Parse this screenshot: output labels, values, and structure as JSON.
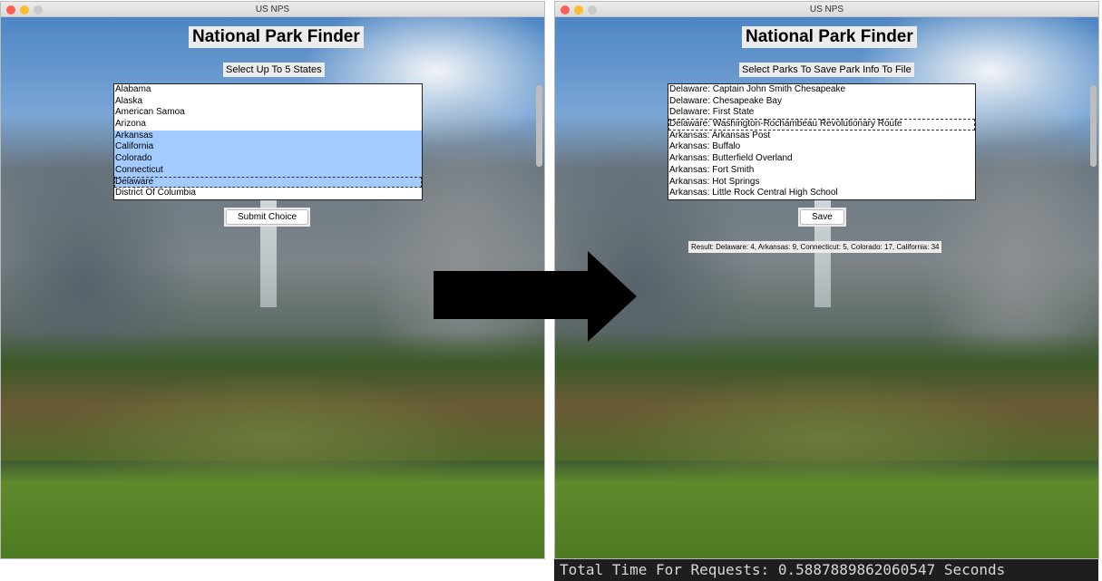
{
  "colors": {
    "selection": "#a4cbff",
    "close": "#fc5f57",
    "minimize": "#fdbc2e",
    "zoom": "#c9c9c9"
  },
  "window1": {
    "title": "US NPS",
    "heading": "National Park Finder",
    "prompt": "Select Up To 5 States",
    "states": [
      {
        "label": "Alabama",
        "selected": false
      },
      {
        "label": "Alaska",
        "selected": false
      },
      {
        "label": "American Samoa",
        "selected": false
      },
      {
        "label": "Arizona",
        "selected": false
      },
      {
        "label": "Arkansas",
        "selected": true
      },
      {
        "label": "California",
        "selected": true
      },
      {
        "label": "Colorado",
        "selected": true
      },
      {
        "label": "Connecticut",
        "selected": true
      },
      {
        "label": "Delaware",
        "selected": true,
        "focused": true
      },
      {
        "label": "District Of Columbia",
        "selected": false
      }
    ],
    "submit_label": "Submit Choice"
  },
  "arrow_icon": "right-arrow-icon",
  "window2": {
    "title": "US NPS",
    "heading": "National Park Finder",
    "prompt": "Select Parks To Save Park Info To File",
    "parks": [
      {
        "label": "Delaware: Captain John Smith Chesapeake"
      },
      {
        "label": "Delaware: Chesapeake Bay"
      },
      {
        "label": "Delaware: First State"
      },
      {
        "label": "Delaware: Washington-Rochambeau Revolutionary Route",
        "focused": true
      },
      {
        "label": "Arkansas: Arkansas Post"
      },
      {
        "label": "Arkansas: Buffalo"
      },
      {
        "label": "Arkansas: Butterfield Overland"
      },
      {
        "label": "Arkansas: Fort Smith"
      },
      {
        "label": "Arkansas: Hot Springs"
      },
      {
        "label": "Arkansas: Little Rock Central High School"
      }
    ],
    "save_label": "Save",
    "result": "Result: Delaware: 4, Arkansas: 9, Connecticut: 5, Colorado: 17, California: 34"
  },
  "terminal": {
    "output": "Total Time For Requests: 0.5887889862060547 Seconds"
  }
}
